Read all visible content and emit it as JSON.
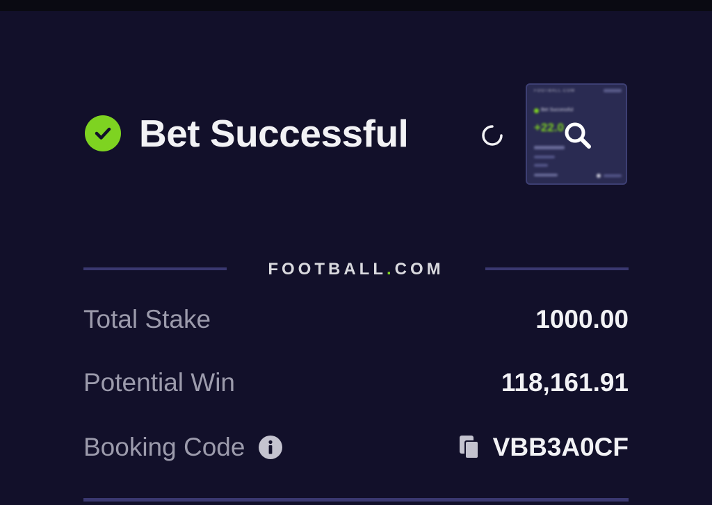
{
  "header": {
    "title": "Bet Successful"
  },
  "thumbnail": {
    "brand": "FOOTBALL.COM",
    "headline": "Bet Successful",
    "value": "+22.0"
  },
  "brand": {
    "prefix": "FOOTBALL",
    "dot": ".",
    "suffix": "COM"
  },
  "details": {
    "total_stake_label": "Total Stake",
    "total_stake_value": "1000.00",
    "potential_win_label": "Potential Win",
    "potential_win_value": "118,161.91",
    "booking_code_label": "Booking Code",
    "booking_code_value": "VBB3A0CF"
  },
  "colors": {
    "background": "#12102a",
    "accent": "#7ed321",
    "divider": "#3a3870",
    "label": "#9c9bac",
    "value": "#f2f2f5"
  }
}
